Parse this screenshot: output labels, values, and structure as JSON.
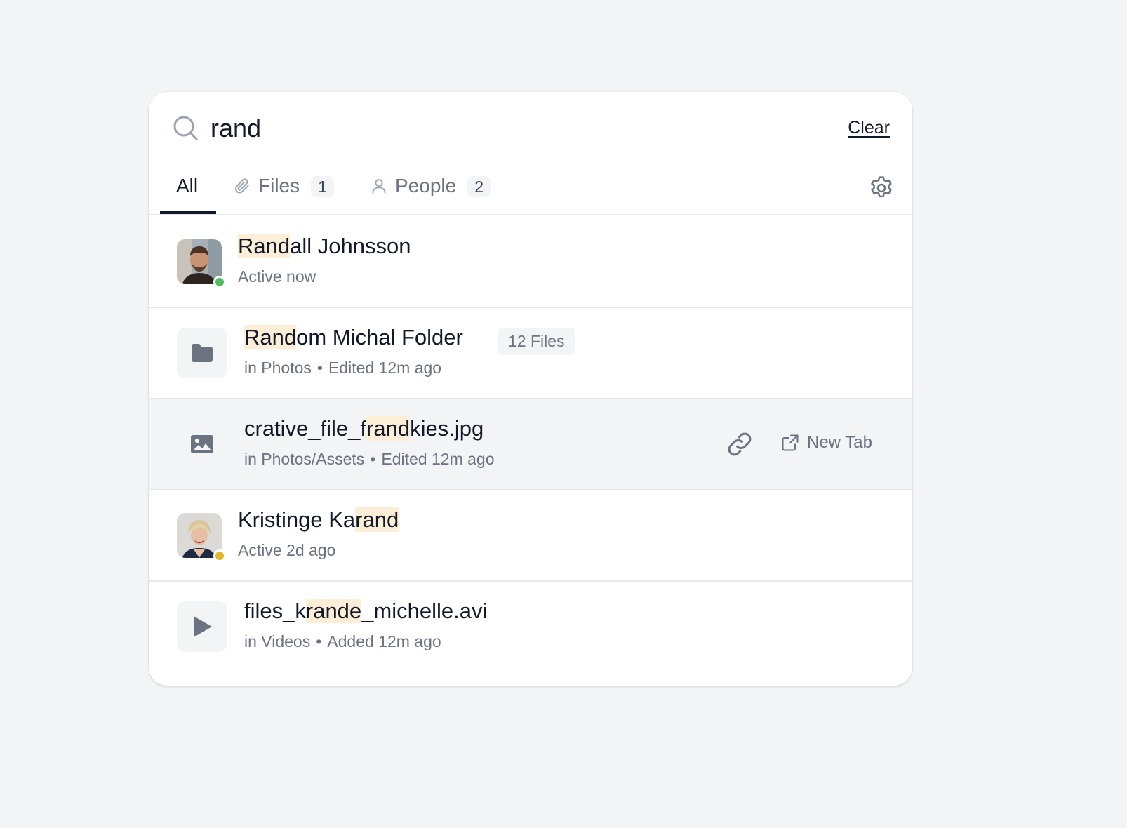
{
  "search": {
    "query": "rand",
    "clear_label": "Clear"
  },
  "tabs": [
    {
      "label": "All",
      "active": true
    },
    {
      "label": "Files",
      "count": "1",
      "icon": "paperclip-icon"
    },
    {
      "label": "People",
      "count": "2",
      "icon": "user-icon"
    }
  ],
  "results": [
    {
      "type": "person",
      "title_match": "Rand",
      "title_rest": "all Johnsson",
      "subtitle": "Active now",
      "status_color": "#4ebd5b"
    },
    {
      "type": "folder",
      "title_match": "Rand",
      "title_rest": "om Michal Folder",
      "badge": "12 Files",
      "location": "in Photos",
      "meta": "Edited 12m ago"
    },
    {
      "type": "image",
      "title_pre": "crative_file_f",
      "title_match": "rand",
      "title_rest": "kies.jpg",
      "location": "in Photos/Assets",
      "meta": "Edited 12m ago",
      "actions": {
        "new_tab_label": "New Tab"
      }
    },
    {
      "type": "person",
      "title_pre": "Kristinge Ka",
      "title_match": "rand",
      "subtitle": "Active 2d ago",
      "status_color": "#e6b52e"
    },
    {
      "type": "video",
      "title_pre": "files_k",
      "title_match": "rande",
      "title_rest": "_michelle.avi",
      "location": "in Videos",
      "meta": "Added 12m ago"
    }
  ],
  "separator": "•",
  "colors": {
    "highlight": "#fdeed8",
    "accent_text": "#111827",
    "muted_text": "#6b7280"
  }
}
